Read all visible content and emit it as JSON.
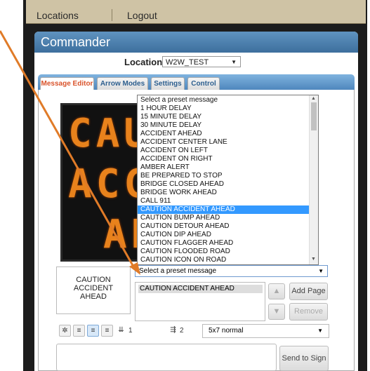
{
  "nav": {
    "locations": "Locations",
    "logout": "Logout"
  },
  "app": {
    "title": "Commander"
  },
  "location": {
    "label": "Location",
    "value": "W2W_TEST"
  },
  "tabs": [
    {
      "label": "Message Editor"
    },
    {
      "label": "Arrow Modes"
    },
    {
      "label": "Settings"
    },
    {
      "label": "Control"
    }
  ],
  "sign_preview": {
    "lines": [
      "CAU",
      "ACCI",
      "AH"
    ],
    "led_color": "#e8821c"
  },
  "preset_dropdown": {
    "items": [
      "Select a preset message",
      "1 HOUR DELAY",
      "15 MINUTE DELAY",
      "30 MINUTE DELAY",
      "ACCIDENT AHEAD",
      "ACCIDENT CENTER LANE",
      "ACCIDENT ON LEFT",
      "ACCIDENT ON RIGHT",
      "AMBER ALERT",
      "BE PREPARED TO STOP",
      "BRIDGE CLOSED AHEAD",
      "BRIDGE WORK AHEAD",
      "CALL 911",
      "CAUTION ACCIDENT AHEAD",
      "CAUTION BUMP AHEAD",
      "CAUTION DETOUR AHEAD",
      "CAUTION DIP AHEAD",
      "CAUTION FLAGGER AHEAD",
      "CAUTION FLOODED ROAD",
      "CAUTION ICON ON ROAD"
    ],
    "highlighted": "CAUTION ACCIDENT AHEAD",
    "selected_value": "Select a preset message"
  },
  "page_preview": {
    "text_line1": "CAUTION",
    "text_line2": "ACCIDENT",
    "text_line3": "AHEAD"
  },
  "pages": {
    "items": [
      "CAUTION ACCIDENT AHEAD"
    ]
  },
  "buttons": {
    "add_page": "Add Page",
    "remove": "Remove",
    "send_to_sign": "Send to Sign",
    "up": "▲",
    "down": "▼"
  },
  "toolbar": {
    "line_spacing_value": "1",
    "char_spacing_value": "2",
    "font_value": "5x7 normal"
  },
  "colors": {
    "accent": "#3d6f9d",
    "highlight": "#3399ff",
    "annotation_arrow": "#e07b28"
  }
}
